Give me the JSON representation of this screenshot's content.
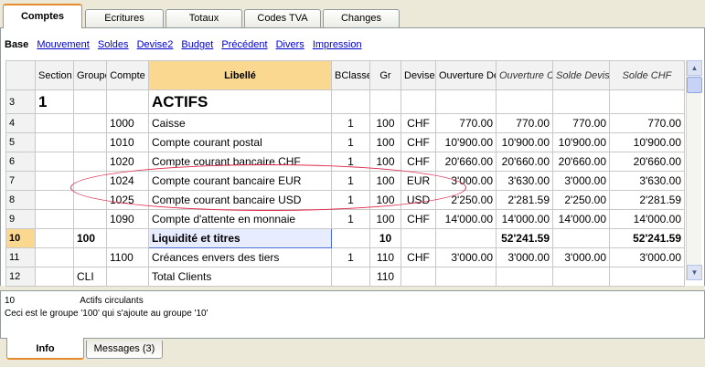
{
  "top_tabs": [
    "Comptes",
    "Ecritures",
    "Totaux",
    "Codes TVA",
    "Changes"
  ],
  "views": {
    "current": "Base",
    "links": [
      "Mouvement",
      "Soldes",
      "Devise2",
      "Budget",
      "Précédent",
      "Divers",
      "Impression"
    ]
  },
  "columns": {
    "section": "Section",
    "groupe": "Groupe",
    "compte": "Compte",
    "libelle": "Libellé",
    "bclasse": "BClasse",
    "gr": "Gr",
    "devise": "Devise",
    "ouv_devise": "Ouverture Devise",
    "ouv_chf": "Ouverture CHF",
    "solde_devise": "Solde Devise",
    "solde_chf": "Solde CHF"
  },
  "rows": [
    {
      "n": "3",
      "section": "1",
      "groupe": "",
      "compte": "",
      "libelle": "ACTIFS",
      "bclasse": "",
      "gr": "",
      "devise": "",
      "ouv_devise": "",
      "ouv_chf": "",
      "solde_devise": "",
      "solde_chf": ""
    },
    {
      "n": "4",
      "section": "",
      "groupe": "",
      "compte": "1000",
      "libelle": "Caisse",
      "bclasse": "1",
      "gr": "100",
      "devise": "CHF",
      "ouv_devise": "770.00",
      "ouv_chf": "770.00",
      "solde_devise": "770.00",
      "solde_chf": "770.00"
    },
    {
      "n": "5",
      "section": "",
      "groupe": "",
      "compte": "1010",
      "libelle": "Compte courant postal",
      "bclasse": "1",
      "gr": "100",
      "devise": "CHF",
      "ouv_devise": "10'900.00",
      "ouv_chf": "10'900.00",
      "solde_devise": "10'900.00",
      "solde_chf": "10'900.00"
    },
    {
      "n": "6",
      "section": "",
      "groupe": "",
      "compte": "1020",
      "libelle": "Compte courant bancaire CHF",
      "bclasse": "1",
      "gr": "100",
      "devise": "CHF",
      "ouv_devise": "20'660.00",
      "ouv_chf": "20'660.00",
      "solde_devise": "20'660.00",
      "solde_chf": "20'660.00"
    },
    {
      "n": "7",
      "section": "",
      "groupe": "",
      "compte": "1024",
      "libelle": "Compte courant bancaire EUR",
      "bclasse": "1",
      "gr": "100",
      "devise": "EUR",
      "ouv_devise": "3'000.00",
      "ouv_chf": "3'630.00",
      "solde_devise": "3'000.00",
      "solde_chf": "3'630.00"
    },
    {
      "n": "8",
      "section": "",
      "groupe": "",
      "compte": "1025",
      "libelle": "Compte courant bancaire USD",
      "bclasse": "1",
      "gr": "100",
      "devise": "USD",
      "ouv_devise": "2'250.00",
      "ouv_chf": "2'281.59",
      "solde_devise": "2'250.00",
      "solde_chf": "2'281.59"
    },
    {
      "n": "9",
      "section": "",
      "groupe": "",
      "compte": "1090",
      "libelle": "Compte d'attente en monnaie",
      "bclasse": "1",
      "gr": "100",
      "devise": "CHF",
      "ouv_devise": "14'000.00",
      "ouv_chf": "14'000.00",
      "solde_devise": "14'000.00",
      "solde_chf": "14'000.00"
    },
    {
      "n": "10",
      "section": "",
      "groupe": "100",
      "compte": "",
      "libelle": "Liquidité et titres",
      "bclasse": "",
      "gr": "10",
      "devise": "",
      "ouv_devise": "",
      "ouv_chf": "52'241.59",
      "solde_devise": "",
      "solde_chf": "52'241.59"
    },
    {
      "n": "11",
      "section": "",
      "groupe": "",
      "compte": "1100",
      "libelle": "Créances envers des tiers",
      "bclasse": "1",
      "gr": "110",
      "devise": "CHF",
      "ouv_devise": "3'000.00",
      "ouv_chf": "3'000.00",
      "solde_devise": "3'000.00",
      "solde_chf": "3'000.00"
    },
    {
      "n": "12",
      "section": "",
      "groupe": "CLI",
      "compte": "",
      "libelle": "Total Clients",
      "bclasse": "",
      "gr": "110",
      "devise": "",
      "ouv_devise": "",
      "ouv_chf": "",
      "solde_devise": "",
      "solde_chf": ""
    }
  ],
  "info": {
    "code": "10",
    "title": "Actifs circulants",
    "description": "Ceci est le groupe '100' qui s'ajoute au groupe '10'"
  },
  "bottom_tabs": [
    "Info",
    "Messages (3)"
  ],
  "colors": {
    "header_highlight": "#fbd88f",
    "annotation": "#e0284b",
    "link": "#0000cc"
  }
}
